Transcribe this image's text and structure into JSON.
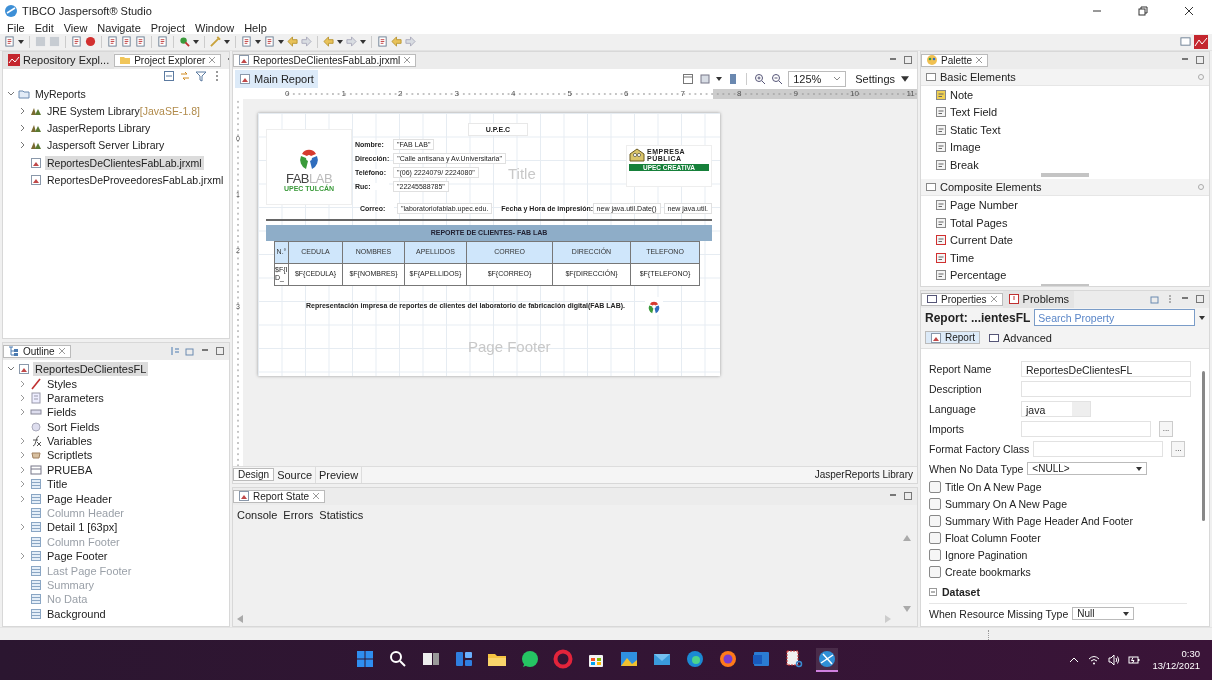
{
  "window": {
    "title": "TIBCO Jaspersoft® Studio"
  },
  "menu": [
    "File",
    "Edit",
    "View",
    "Navigate",
    "Project",
    "Window",
    "Help"
  ],
  "explorer": {
    "tabs": [
      {
        "label": "Repository Expl...",
        "selected": false
      },
      {
        "label": "Project Explorer",
        "selected": true
      }
    ],
    "tree": {
      "label": "MyReports",
      "expanded": true,
      "children": [
        {
          "kind": "library",
          "label": "JRE System Library",
          "note": "[JavaSE-1.8]",
          "selected": false
        },
        {
          "kind": "library",
          "label": "JasperReports Library",
          "selected": false
        },
        {
          "kind": "library",
          "label": "Jaspersoft Server Library",
          "selected": false
        },
        {
          "kind": "file",
          "label": "ReportesDeClientesFabLab.jrxml",
          "selected": true
        },
        {
          "kind": "file",
          "label": "ReportesDeProveedoresFabLab.jrxml",
          "selected": false
        }
      ]
    }
  },
  "outline": {
    "title": "Outline",
    "tree": {
      "label": "ReportesDeClientesFL",
      "expanded": true,
      "children": [
        {
          "kind": "node",
          "label": "Styles",
          "disabled": false
        },
        {
          "kind": "node",
          "label": "Parameters",
          "disabled": false
        },
        {
          "kind": "node",
          "label": "Fields",
          "disabled": false
        },
        {
          "kind": "leaf",
          "label": "Sort Fields",
          "disabled": false
        },
        {
          "kind": "node",
          "label": "Variables",
          "disabled": false
        },
        {
          "kind": "node",
          "label": "Scriptlets",
          "disabled": false
        },
        {
          "kind": "node",
          "label": "PRUEBA",
          "disabled": false
        },
        {
          "kind": "node",
          "label": "Title",
          "disabled": false
        },
        {
          "kind": "node",
          "label": "Page Header",
          "disabled": false
        },
        {
          "kind": "leaf",
          "label": "Column Header",
          "disabled": true
        },
        {
          "kind": "node",
          "label": "Detail 1 [63px]",
          "disabled": false
        },
        {
          "kind": "leaf",
          "label": "Column Footer",
          "disabled": true
        },
        {
          "kind": "node",
          "label": "Page Footer",
          "disabled": false
        },
        {
          "kind": "leaf",
          "label": "Last Page Footer",
          "disabled": true
        },
        {
          "kind": "leaf",
          "label": "Summary",
          "disabled": true
        },
        {
          "kind": "leaf",
          "label": "No Data",
          "disabled": true
        },
        {
          "kind": "leaf",
          "label": "Background",
          "disabled": false
        }
      ]
    }
  },
  "editor": {
    "tab": "ReportesDeClientesFabLab.jrxml",
    "view_tab": "Main Report",
    "zoom": "125%",
    "settings": "Settings",
    "ruler": [
      "0",
      "1",
      "2",
      "3",
      "4",
      "5",
      "6",
      "7",
      "8",
      "9",
      "10",
      "11"
    ],
    "vertical_ruler": [
      "0",
      "1",
      "2",
      "3"
    ],
    "report": {
      "heading": "U.P.E.C",
      "fablab_logo": {
        "word_1": "FAB",
        "word_2": "LAB",
        "subtitle": "UPEC TULCÁN"
      },
      "company_logo": {
        "line_1": "EMPRESA",
        "line_2": "PÚBLICA",
        "line_3": "UPEC CREATIVA"
      },
      "fields": [
        {
          "label": "Nombre:",
          "value": "\"FAB LAB\""
        },
        {
          "label": "Dirección:",
          "value": "\"Calle antisana y Av.Universitaria\""
        },
        {
          "label": "Teléfono:",
          "value": "\"(06) 2224079/ 2224080\""
        },
        {
          "label": "Ruc:",
          "value": "\"22245588785\""
        }
      ],
      "email": {
        "label": "Correo:",
        "value": "\"laboratoriofablab.upec.edu."
      },
      "print_date": {
        "label": "Fecha y Hora de impresión:",
        "value": "new java.util.Date()",
        "value_2": "new java.util."
      },
      "title_band": "Title",
      "table_title": "REPORTE DE CLIENTES- FAB LAB",
      "columns": [
        "N.°",
        "CEDULA",
        "NOMBRES",
        "APELLIDOS",
        "CORREO",
        "DIRECCIÓN",
        "TELEFONO"
      ],
      "row": [
        "$F{ID_",
        "$F{CEDULA}",
        "$F{NOMBRES}",
        "$F{APELLIDOS}",
        "$F{CORREO}",
        "$F{DIRECCIÓN}",
        "$F{TELEFONO}"
      ],
      "footer_text": "Representación impresa de reportes de clientes del laboratorio de fabricación digital(FAB LAB).",
      "footer_band": "Page Footer"
    },
    "bottom_tabs": [
      {
        "label": "Design",
        "selected": true
      },
      {
        "label": "Source",
        "selected": false
      },
      {
        "label": "Preview",
        "selected": false
      }
    ],
    "library_label": "JasperReports Library"
  },
  "report_state": {
    "title": "Report State",
    "tabs": [
      "Console",
      "Errors",
      "Statistics"
    ]
  },
  "palette": {
    "title": "Palette",
    "groups": [
      {
        "label": "Basic Elements",
        "items": [
          "Note",
          "Text Field",
          "Static Text",
          "Image",
          "Break"
        ]
      },
      {
        "label": "Composite Elements",
        "items": [
          "Page Number",
          "Total Pages",
          "Current Date",
          "Time",
          "Percentage"
        ]
      }
    ]
  },
  "properties": {
    "tabs": [
      {
        "label": "Properties",
        "selected": true
      },
      {
        "label": "Problems",
        "selected": false
      }
    ],
    "header": "Report: ...ientesFL",
    "search_placeholder": "Search Property",
    "subtabs": [
      {
        "label": "Report",
        "selected": true
      },
      {
        "label": "Advanced",
        "selected": false
      }
    ],
    "rows": [
      {
        "kind": "text",
        "label": "Report Name",
        "value": "ReportesDeClientesFL"
      },
      {
        "kind": "text",
        "label": "Description"
      },
      {
        "kind": "short",
        "label": "Language",
        "value": "java"
      },
      {
        "kind": "browse",
        "label": "Imports",
        "button": "..."
      },
      {
        "kind": "browse",
        "label": "Format Factory Class",
        "button": "..."
      },
      {
        "kind": "select",
        "label": "When No Data Type",
        "value": "<NULL>"
      },
      {
        "kind": "checkbox",
        "label": "Title On A New Page",
        "checked": false
      },
      {
        "kind": "checkbox",
        "label": "Summary On A New Page",
        "checked": false
      },
      {
        "kind": "checkbox",
        "label": "Summary With Page Header And Footer",
        "checked": false
      },
      {
        "kind": "checkbox",
        "label": "Float Column Footer",
        "checked": false
      },
      {
        "kind": "checkbox",
        "label": "Ignore Pagination",
        "checked": false
      },
      {
        "kind": "checkbox",
        "label": "Create bookmarks",
        "checked": false
      },
      {
        "kind": "section",
        "label": "Dataset"
      },
      {
        "kind": "select",
        "label": "When Resource Missing Type",
        "value": "Null"
      }
    ]
  },
  "taskbar": {
    "time": "0:30",
    "date": "13/12/2021"
  }
}
